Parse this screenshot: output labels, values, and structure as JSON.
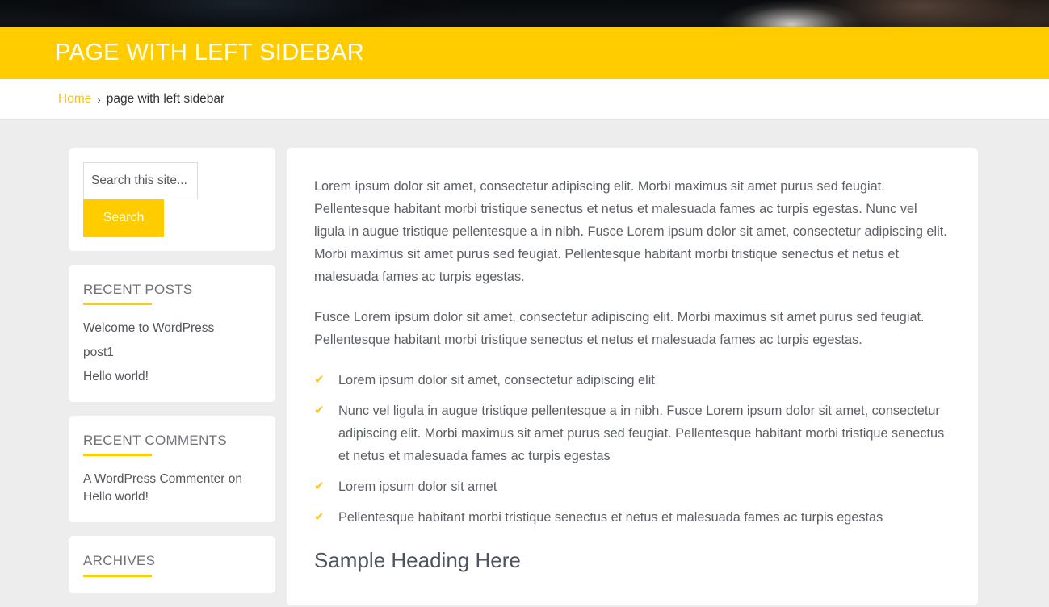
{
  "theme": {
    "accent_color": "#ffcc00",
    "page_background": "#ededed",
    "card_background": "#ffffff",
    "body_text_color": "#5c6066",
    "heading_text_color": "#6f7278"
  },
  "hero": {
    "description": "dark cropped header image strip"
  },
  "header": {
    "page_title": "PAGE WITH LEFT SIDEBAR"
  },
  "breadcrumb": {
    "home_label": "Home",
    "separator": "›",
    "current_label": "page with left sidebar"
  },
  "sidebar": {
    "search": {
      "placeholder": "Search this site...",
      "value": "",
      "button_label": "Search"
    },
    "widgets": [
      {
        "title": "RECENT POSTS",
        "items": [
          "Welcome to WordPress",
          "post1",
          "Hello world!"
        ]
      },
      {
        "title": "RECENT COMMENTS",
        "comment_author": "A WordPress Commenter",
        "comment_on": "on",
        "comment_post": "Hello world!"
      },
      {
        "title": "ARCHIVES"
      }
    ]
  },
  "main": {
    "paragraphs": [
      "Lorem ipsum dolor sit amet, consectetur adipiscing elit. Morbi maximus sit amet purus sed feugiat. Pellentesque habitant morbi tristique senectus et netus et malesuada fames ac turpis egestas. Nunc vel ligula in augue tristique pellentesque a in nibh. Fusce Lorem ipsum dolor sit amet, consectetur adipiscing elit. Morbi maximus sit amet purus sed feugiat. Pellentesque habitant morbi tristique senectus et netus et malesuada fames ac turpis egestas.",
      "Fusce Lorem ipsum dolor sit amet, consectetur adipiscing elit. Morbi maximus sit amet purus sed feugiat. Pellentesque habitant morbi tristique senectus et netus et malesuada fames ac turpis egestas."
    ],
    "check_icon": "✔",
    "check_list": [
      "Lorem ipsum dolor sit amet, consectetur adipiscing elit",
      "Nunc vel ligula in augue tristique pellentesque a in nibh. Fusce Lorem ipsum dolor sit amet, consectetur adipiscing elit. Morbi maximus sit amet purus sed feugiat. Pellentesque habitant morbi tristique senectus et netus et malesuada fames ac turpis egestas",
      "Lorem ipsum dolor sit amet",
      "Pellentesque habitant morbi tristique senectus et netus et malesuada fames ac turpis egestas"
    ],
    "heading": "Sample Heading Here"
  }
}
